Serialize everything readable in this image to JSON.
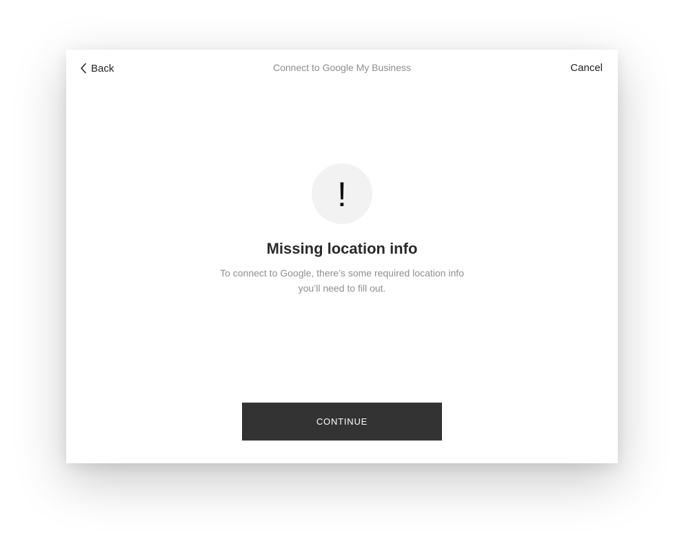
{
  "header": {
    "back_label": "Back",
    "title": "Connect to Google My Business",
    "cancel_label": "Cancel"
  },
  "alert": {
    "icon": "exclamation-icon",
    "symbol": "!",
    "heading": "Missing location info",
    "message": "To connect to Google, there’s some required location info you’ll need to fill out."
  },
  "footer": {
    "continue_label": "CONTINUE"
  },
  "colors": {
    "button_bg": "#333333",
    "icon_circle_bg": "#f2f2f2",
    "muted_text": "#8e8e8e"
  }
}
